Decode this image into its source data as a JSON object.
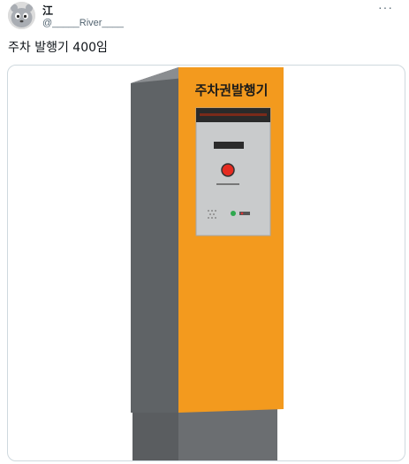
{
  "author": {
    "display_name": "江",
    "handle": "@_____River____"
  },
  "tweet": {
    "text": "주차 발행기 400임",
    "more_icon": "···"
  },
  "media": {
    "sign_text": "주차권발행기",
    "colors": {
      "body": "#f39a1e",
      "side": "#5f6366",
      "panel": "#c9cbcc",
      "button": "#e52b20"
    }
  }
}
